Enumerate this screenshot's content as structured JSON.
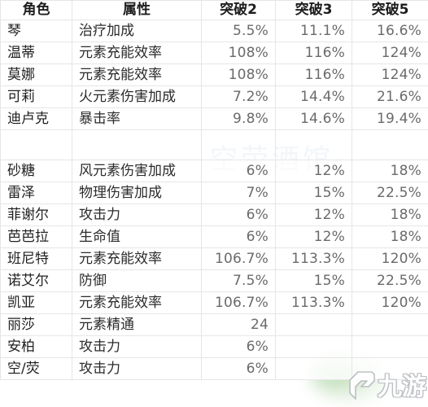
{
  "table": {
    "headers": [
      "角色",
      "属性",
      "突破2",
      "突破3",
      "突破5"
    ],
    "rows": [
      {
        "name": "琴",
        "attr": "治疗加成",
        "a2": "5.5%",
        "a3": "11.1%",
        "a5": "16.6%"
      },
      {
        "name": "温蒂",
        "attr": "元素充能效率",
        "a2": "108%",
        "a3": "116%",
        "a5": "124%"
      },
      {
        "name": "莫娜",
        "attr": "元素充能效率",
        "a2": "108%",
        "a3": "116%",
        "a5": "124%"
      },
      {
        "name": "可莉",
        "attr": "火元素伤害加成",
        "a2": "7.2%",
        "a3": "14.4%",
        "a5": "21.6%"
      },
      {
        "name": "迪卢克",
        "attr": "暴击率",
        "a2": "9.8%",
        "a3": "14.6%",
        "a5": "19.4%"
      },
      {
        "name": "",
        "attr": "",
        "a2": "",
        "a3": "",
        "a5": "",
        "spacer": true
      },
      {
        "name": "砂糖",
        "attr": "风元素伤害加成",
        "a2": "6%",
        "a3": "12%",
        "a5": "18%"
      },
      {
        "name": "雷泽",
        "attr": "物理伤害加成",
        "a2": "7%",
        "a3": "15%",
        "a5": "22.5%"
      },
      {
        "name": "菲谢尔",
        "attr": "攻击力",
        "a2": "6%",
        "a3": "12%",
        "a5": "18%"
      },
      {
        "name": "芭芭拉",
        "attr": "生命值",
        "a2": "6%",
        "a3": "12%",
        "a5": "18%"
      },
      {
        "name": "班尼特",
        "attr": "元素充能效率",
        "a2": "106.7%",
        "a3": "113.3%",
        "a5": "120%"
      },
      {
        "name": "诺艾尔",
        "attr": "防御",
        "a2": "7.5%",
        "a3": "15%",
        "a5": "22.5%"
      },
      {
        "name": "凯亚",
        "attr": "元素充能效率",
        "a2": "106.7%",
        "a3": "113.3%",
        "a5": "120%"
      },
      {
        "name": "丽莎",
        "attr": "元素精通",
        "a2": "24",
        "a3": null,
        "a5": null
      },
      {
        "name": "安柏",
        "attr": "攻击力",
        "a2": "6%",
        "a3": null,
        "a5": null
      },
      {
        "name": "空/荧",
        "attr": "攻击力",
        "a2": "6%",
        "a3": null,
        "a5": null
      }
    ]
  },
  "watermarks": {
    "center_text": "空荧酒馆",
    "center_color": "#e3eaf2",
    "logo_text": "九游",
    "logo_color": "#ffffff",
    "logo_outline_color": "#b9bcc0",
    "glow_color": "#7abc6e"
  },
  "chart_data": {
    "type": "table",
    "title": "角色突破属性表",
    "columns": [
      "角色",
      "属性",
      "突破2",
      "突破3",
      "突破5"
    ],
    "rows": [
      [
        "琴",
        "治疗加成",
        "5.5%",
        "11.1%",
        "16.6%"
      ],
      [
        "温蒂",
        "元素充能效率",
        "108%",
        "116%",
        "124%"
      ],
      [
        "莫娜",
        "元素充能效率",
        "108%",
        "116%",
        "124%"
      ],
      [
        "可莉",
        "火元素伤害加成",
        "7.2%",
        "14.4%",
        "21.6%"
      ],
      [
        "迪卢克",
        "暴击率",
        "9.8%",
        "14.6%",
        "19.4%"
      ],
      [
        "",
        "",
        "",
        "",
        ""
      ],
      [
        "砂糖",
        "风元素伤害加成",
        "6%",
        "12%",
        "18%"
      ],
      [
        "雷泽",
        "物理伤害加成",
        "7%",
        "15%",
        "22.5%"
      ],
      [
        "菲谢尔",
        "攻击力",
        "6%",
        "12%",
        "18%"
      ],
      [
        "芭芭拉",
        "生命值",
        "6%",
        "12%",
        "18%"
      ],
      [
        "班尼特",
        "元素充能效率",
        "106.7%",
        "113.3%",
        "120%"
      ],
      [
        "诺艾尔",
        "防御",
        "7.5%",
        "15%",
        "22.5%"
      ],
      [
        "凯亚",
        "元素充能效率",
        "106.7%",
        "113.3%",
        "120%"
      ],
      [
        "丽莎",
        "元素精通",
        "24",
        "",
        ""
      ],
      [
        "安柏",
        "攻击力",
        "6%",
        "",
        ""
      ],
      [
        "空/荧",
        "攻击力",
        "6%",
        "",
        ""
      ]
    ]
  }
}
